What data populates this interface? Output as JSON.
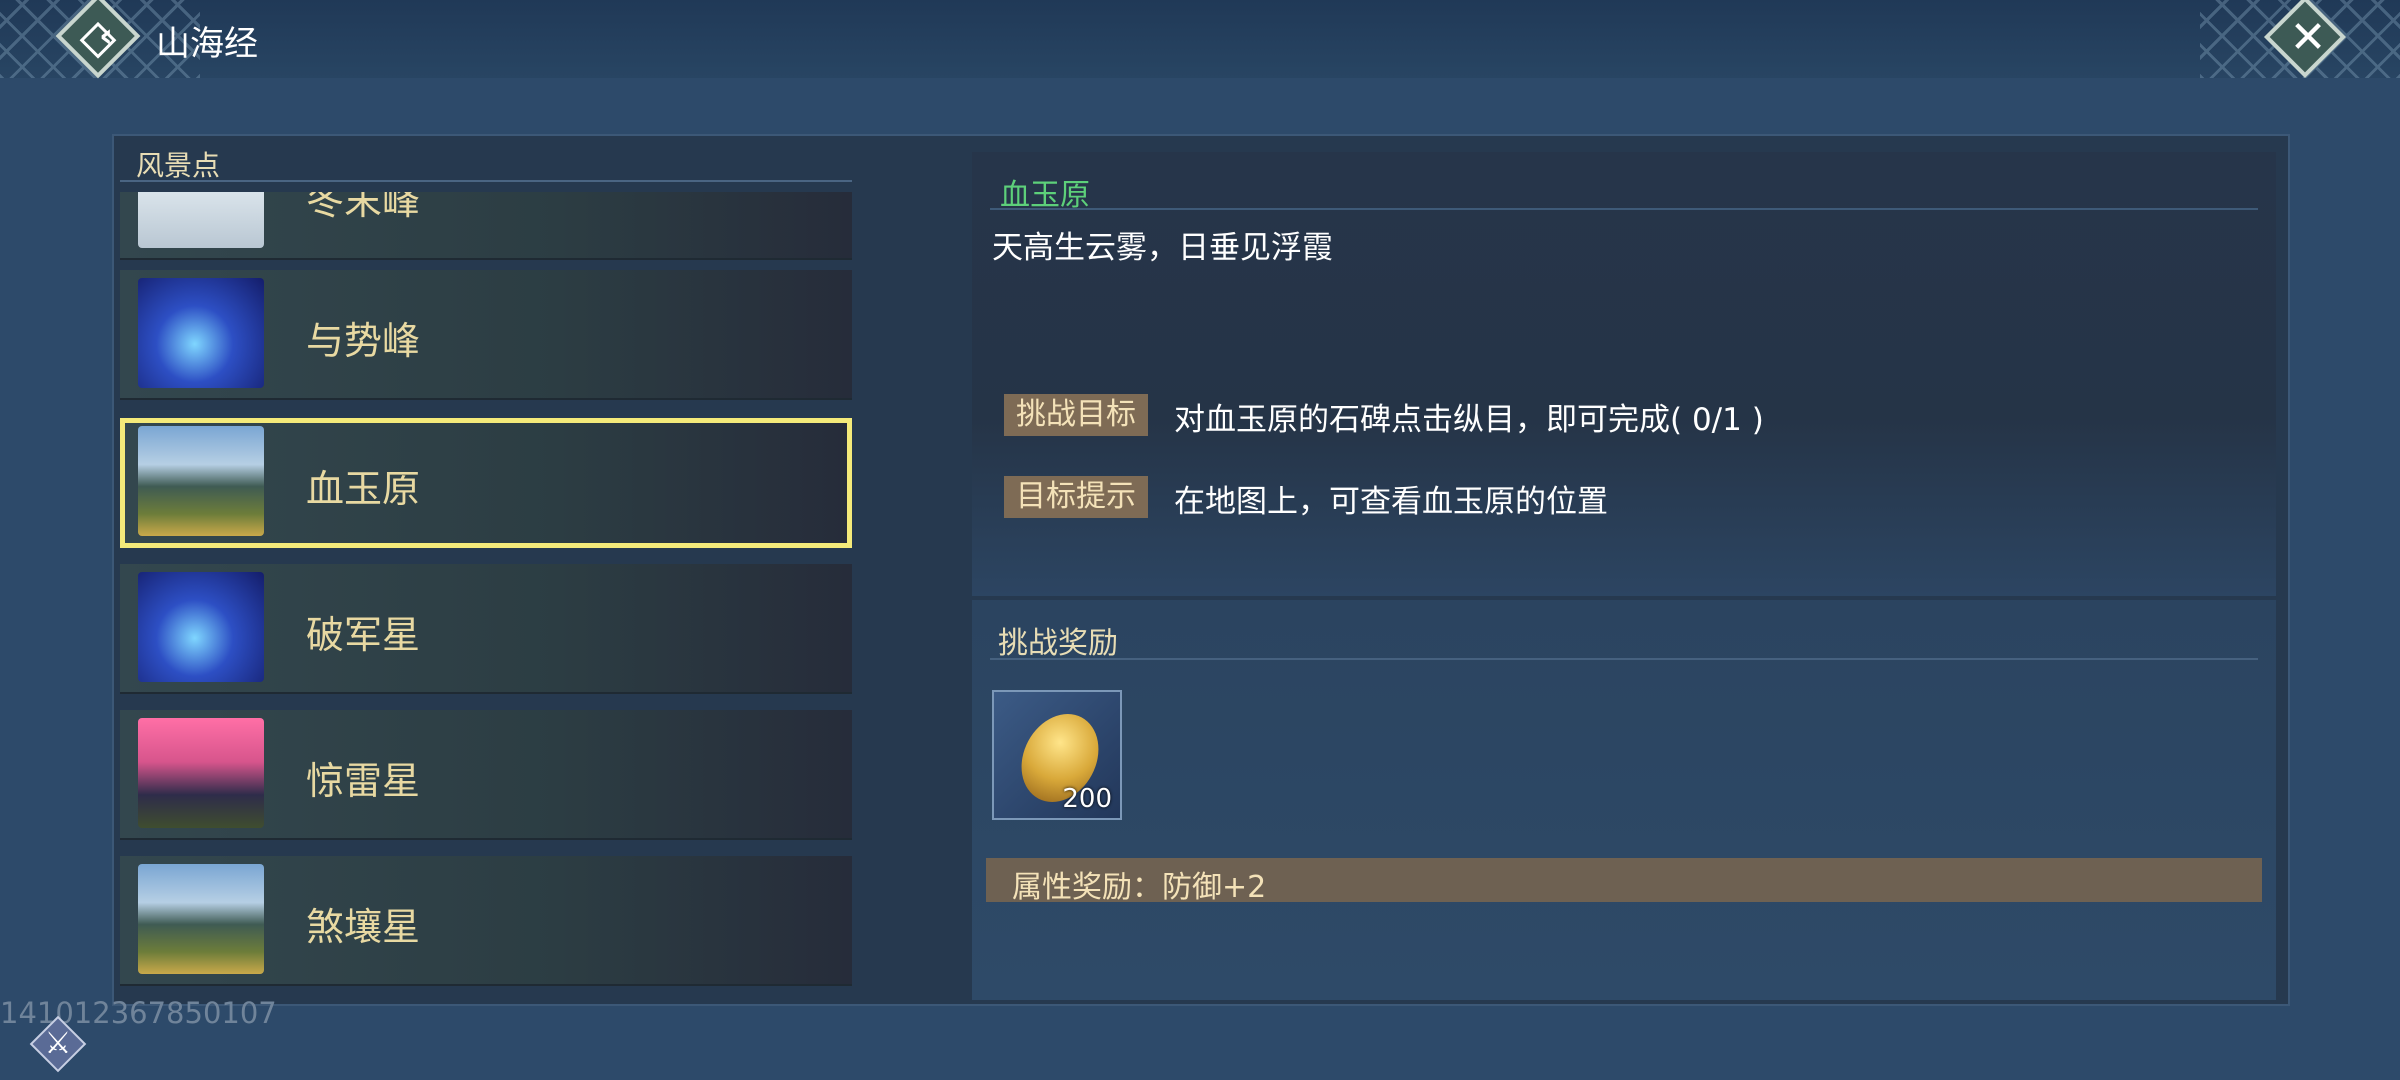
{
  "header": {
    "title": "山海经"
  },
  "left": {
    "title": "风景点",
    "items": [
      {
        "label": "冬末峰",
        "thumb": "snow-peak"
      },
      {
        "label": "与势峰",
        "thumb": "blue-coral"
      },
      {
        "label": "血玉原",
        "thumb": "mountain-lake",
        "selected": true
      },
      {
        "label": "破军星",
        "thumb": "blue-coral"
      },
      {
        "label": "惊雷星",
        "thumb": "pink-sunset"
      },
      {
        "label": "煞壤星",
        "thumb": "mountain-lake"
      }
    ]
  },
  "detail": {
    "name": "血玉原",
    "description": "天高生云雾，日垂见浮霞",
    "rows": [
      {
        "tag": "挑战目标",
        "text": "对血玉原的石碑点击纵目，即可完成( 0/1 )"
      },
      {
        "tag": "目标提示",
        "text": "在地图上，可查看血玉原的位置"
      }
    ]
  },
  "reward": {
    "title": "挑战奖励",
    "item_count": "200",
    "attr_text": "属性奖励：防御+2"
  },
  "footer": {
    "uid": "141012367850107"
  },
  "colors": {
    "selected_border": "#f4ea7a",
    "place_name": "#5dd07a",
    "tag_bg": "#7e6b55"
  }
}
